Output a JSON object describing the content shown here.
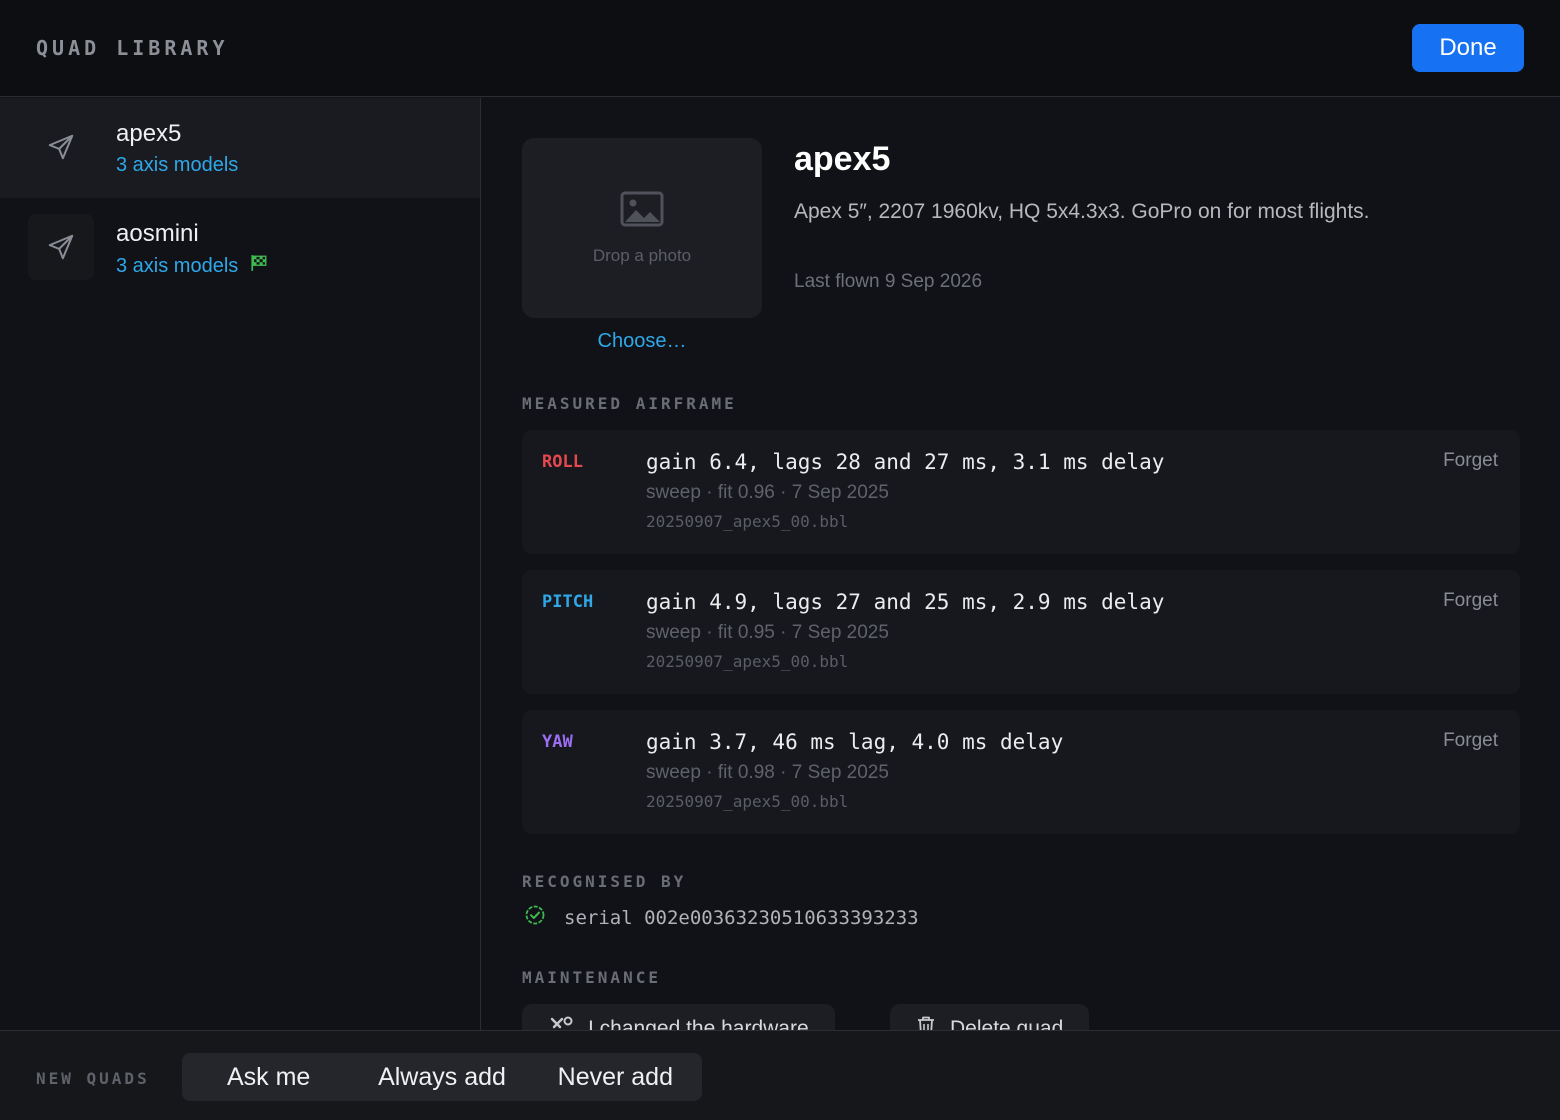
{
  "header": {
    "title": "QUAD LIBRARY",
    "done_label": "Done"
  },
  "sidebar": {
    "items": [
      {
        "name": "apex5",
        "subtitle": "3 axis models",
        "selected": true,
        "icon": "paper-plane-icon"
      },
      {
        "name": "aosmini",
        "subtitle": "3 axis models",
        "selected": false,
        "icon": "paper-plane-icon",
        "badge_icon": "checkered-flag-icon"
      }
    ]
  },
  "detail": {
    "photo_placeholder": "Drop a photo",
    "choose_label": "Choose…",
    "name": "apex5",
    "description": "Apex 5″, 2207 1960kv, HQ 5x4.3x3. GoPro on for most flights.",
    "last_flown": "Last flown 9 Sep 2026"
  },
  "airframe": {
    "section_label": "MEASURED AIRFRAME",
    "axes": [
      {
        "axis": "ROLL",
        "color": "#e5484d",
        "summary": "gain 6.4, lags 28 and 27 ms, 3.1 ms delay",
        "meta": "sweep · fit 0.96 · 7 Sep 2025",
        "file": "20250907_apex5_00.bbl",
        "action": "Forget"
      },
      {
        "axis": "PITCH",
        "color": "#2ea8e8",
        "summary": "gain 4.9, lags 27 and 25 ms, 2.9 ms delay",
        "meta": "sweep · fit 0.95 · 7 Sep 2025",
        "file": "20250907_apex5_00.bbl",
        "action": "Forget"
      },
      {
        "axis": "YAW",
        "color": "#9b6ef3",
        "summary": "gain 3.7, 46 ms lag, 4.0 ms delay",
        "meta": "sweep · fit 0.98 · 7 Sep 2025",
        "file": "20250907_apex5_00.bbl",
        "action": "Forget"
      }
    ]
  },
  "recognised": {
    "section_label": "RECOGNISED BY",
    "serial": "serial 002e00363230510633393233",
    "icon": "check-circle-icon",
    "icon_color": "#3fb950"
  },
  "maintenance": {
    "section_label": "MAINTENANCE",
    "changed_hw_label": "I changed the hardware",
    "delete_label": "Delete quad"
  },
  "footer": {
    "label": "NEW QUADS",
    "options": [
      "Ask me",
      "Always add",
      "Never add"
    ]
  },
  "colors": {
    "accent": "#1672f3",
    "link": "#2ea8e8"
  }
}
